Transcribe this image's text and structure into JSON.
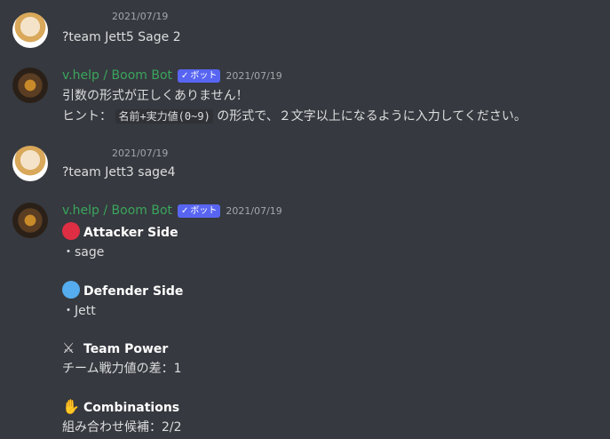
{
  "messages": [
    {
      "timestamp": "2021/07/19",
      "text": "?team Jett5 Sage 2"
    },
    {
      "username": "v.help / Boom Bot",
      "bot_tag": "ボット",
      "timestamp": "2021/07/19",
      "line1": "引数の形式が正しくありません！",
      "line2_prefix": "ヒント：",
      "line2_code": "名前+実力値(0~9)",
      "line2_suffix": "の形式で、２文字以上になるように入力してください。"
    },
    {
      "timestamp": "2021/07/19",
      "text": "?team Jett3 sage4"
    },
    {
      "username": "v.help / Boom Bot",
      "bot_tag": "ボット",
      "timestamp": "2021/07/19",
      "attacker_title": "Attacker Side",
      "attacker_value": "・sage",
      "defender_title": "Defender Side",
      "defender_value": "・Jett",
      "power_title": "Team Power",
      "power_value": "チーム戦力値の差：1",
      "combo_title": "Combinations",
      "combo_value": "組み合わせ候補：2/2"
    }
  ],
  "icons": {
    "attacker": "red-circle-icon",
    "defender": "blue-circle-icon",
    "power": "crossed-swords-icon",
    "combo": "handshake-icon"
  }
}
